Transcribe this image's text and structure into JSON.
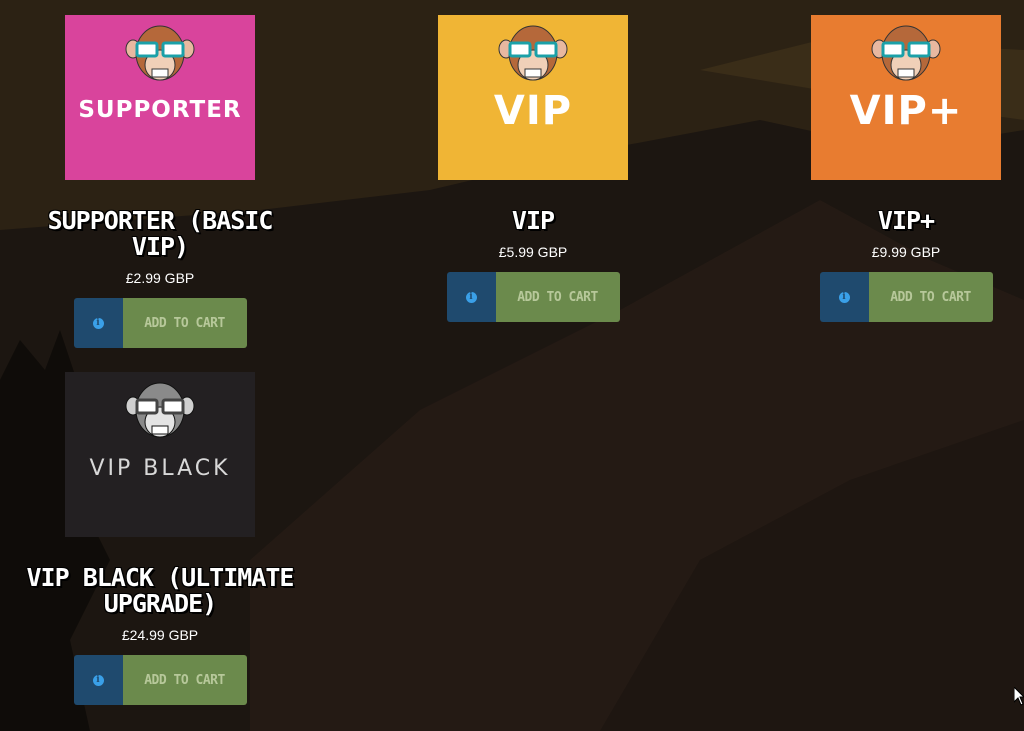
{
  "colors": {
    "supporter": "#d9449c",
    "vip": "#f0b535",
    "vip_plus": "#e87c30",
    "vip_black": "#232022",
    "info_button": "#1f4a6e",
    "cart_button": "#6b8a4c",
    "cart_text": "#b7c89a"
  },
  "products": [
    {
      "image_label": "SUPPORTER",
      "title": "SUPPORTER (BASIC VIP)",
      "price": "£2.99 GBP",
      "info_icon": "i",
      "cart_label": "ADD TO CART"
    },
    {
      "image_label": "VIP",
      "title": "VIP",
      "price": "£5.99 GBP",
      "info_icon": "i",
      "cart_label": "ADD TO CART"
    },
    {
      "image_label": "VIP+",
      "title": "VIP+",
      "price": "£9.99 GBP",
      "info_icon": "i",
      "cart_label": "ADD TO CART"
    },
    {
      "image_label": "VIP BLACK",
      "title": "VIP BLACK (ULTIMATE UPGRADE)",
      "price": "£24.99 GBP",
      "info_icon": "i",
      "cart_label": "ADD TO CART"
    }
  ],
  "icons": {
    "info": "info-circle-icon",
    "mascot": "monkey-glasses-icon",
    "cursor": "mouse-pointer-icon"
  }
}
